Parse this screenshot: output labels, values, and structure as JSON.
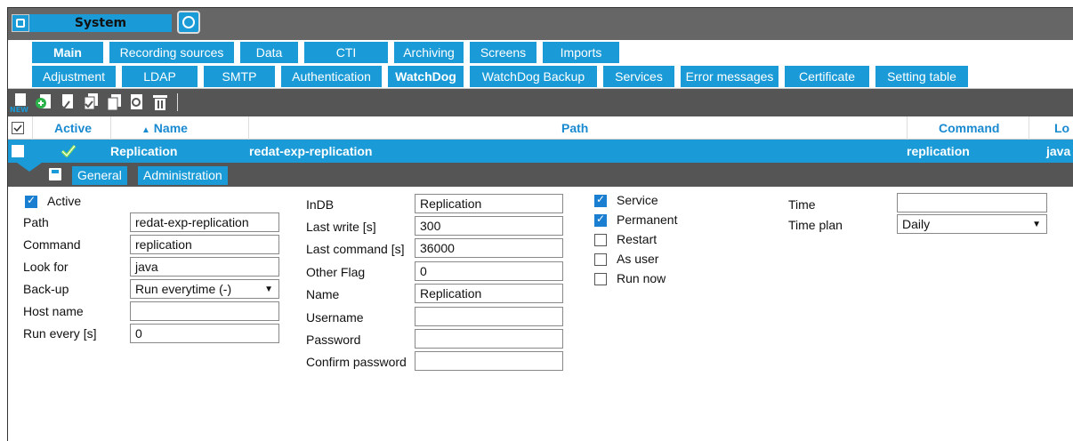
{
  "header": {
    "system_label": "System"
  },
  "main_tabs": [
    "Main",
    "Recording sources",
    "Data",
    "CTI",
    "Archiving",
    "Screens",
    "Imports"
  ],
  "sub_tabs": [
    "Adjustment",
    "LDAP",
    "SMTP",
    "Authentication",
    "WatchDog",
    "WatchDog Backup",
    "Services",
    "Error messages",
    "Certificate",
    "Setting table"
  ],
  "toolbar": {
    "new_label": "NEW"
  },
  "grid": {
    "headers": {
      "active": "Active",
      "name": "Name",
      "path": "Path",
      "command": "Command",
      "lookfor": "Lo"
    },
    "row": {
      "name": "Replication",
      "path": "redat-exp-replication",
      "command": "replication",
      "lookfor": "java"
    }
  },
  "detail_tabs": {
    "general": "General",
    "administration": "Administration"
  },
  "form": {
    "active_label": "Active",
    "path_label": "Path",
    "path_value": "redat-exp-replication",
    "command_label": "Command",
    "command_value": "replication",
    "lookfor_label": "Look for",
    "lookfor_value": "java",
    "backup_label": "Back-up",
    "backup_value": "Run everytime (-)",
    "hostname_label": "Host name",
    "hostname_value": "",
    "runevery_label": "Run every [s]",
    "runevery_value": "0",
    "indb_label": "InDB",
    "indb_value": "Replication",
    "lastwrite_label": "Last write [s]",
    "lastwrite_value": "300",
    "lastcommand_label": "Last command [s]",
    "lastcommand_value": "36000",
    "otherflag_label": "Other Flag",
    "otherflag_value": "0",
    "name_label": "Name",
    "name_value": "Replication",
    "username_label": "Username",
    "username_value": "",
    "password_label": "Password",
    "password_value": "",
    "confirm_label": "Confirm password",
    "confirm_value": "",
    "service_label": "Service",
    "permanent_label": "Permanent",
    "restart_label": "Restart",
    "asuser_label": "As user",
    "runnow_label": "Run now",
    "time_label": "Time",
    "time_value": "",
    "timeplan_label": "Time plan",
    "timeplan_value": "Daily"
  },
  "colors": {
    "accent": "#1a9ad6",
    "bar": "#666666",
    "toolbar": "#555555"
  }
}
